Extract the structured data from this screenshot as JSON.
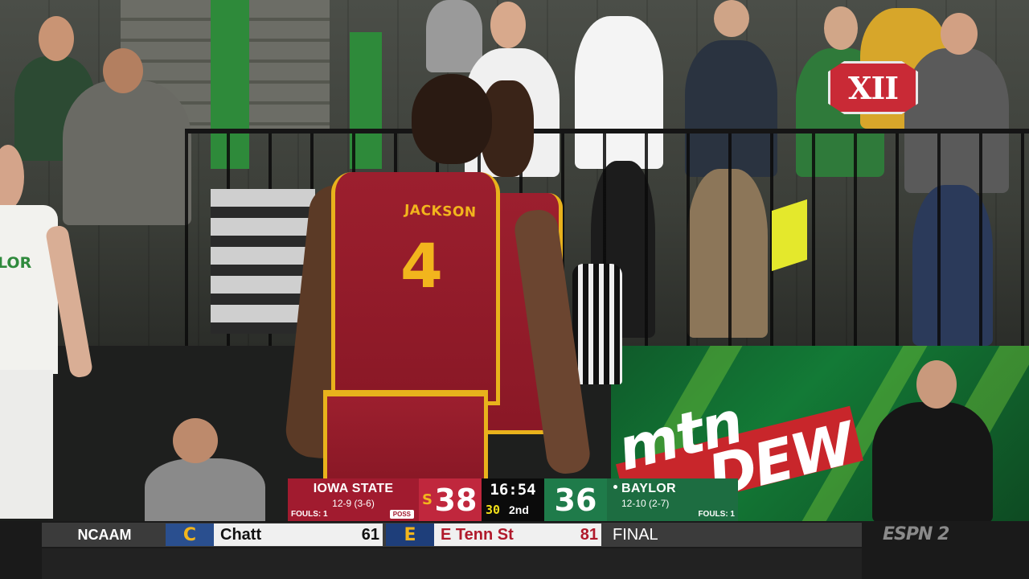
{
  "broadcast": {
    "watermark_logo": "XII",
    "network": "ESPN 2",
    "ad_board_text": [
      "mtn",
      "DEW"
    ]
  },
  "scene": {
    "player_name": "JACKSON",
    "player_number": "4",
    "opponent_jersey_text": "LOR"
  },
  "scorebug": {
    "home": {
      "name": "IOWA STATE",
      "record": "12-9 (3-6)",
      "fouls": "FOULS: 1",
      "possession": "POSS",
      "score": "38",
      "logo": "S",
      "color": "#a11b2f"
    },
    "clock": "16:54",
    "shot_clock": "30",
    "period": "2nd",
    "away": {
      "name": "BAYLOR",
      "record": "12-10 (2-7)",
      "fouls": "FOULS: 1",
      "score": "36",
      "color": "#1d6d41"
    }
  },
  "ticker": {
    "league": "NCAAM",
    "team1": {
      "logo": "C",
      "name": "Chatt",
      "score": "61",
      "logo_color": "#f2b51d",
      "logo_bg": "#2a4f8f"
    },
    "team2": {
      "logo": "E",
      "name": "E Tenn St",
      "score": "81",
      "logo_color": "#f2b51d",
      "logo_bg": "#1e3e7a"
    },
    "status": "FINAL"
  }
}
